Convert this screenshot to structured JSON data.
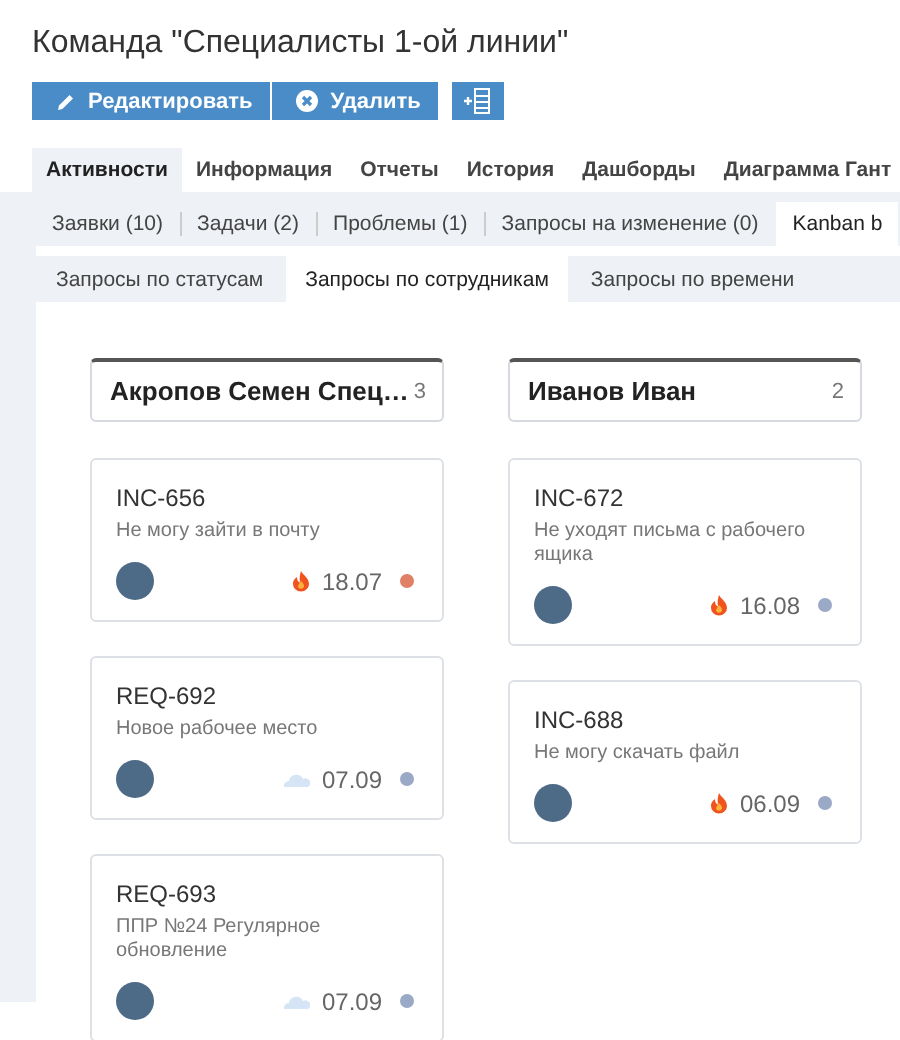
{
  "title": "Команда \"Специалисты 1-ой линии\"",
  "toolbar": [
    {
      "kind": "edit",
      "label": "Редактировать"
    },
    {
      "kind": "delete",
      "label": "Удалить"
    },
    {
      "kind": "add-column"
    }
  ],
  "tabs": [
    {
      "label": "Активности",
      "selected": true
    },
    {
      "label": "Информация",
      "selected": false
    },
    {
      "label": "Отчеты",
      "selected": false
    },
    {
      "label": "История",
      "selected": false
    },
    {
      "label": "Дашборды",
      "selected": false
    },
    {
      "label": "Диаграмма Гант",
      "selected": false
    }
  ],
  "subtabs": [
    {
      "label": "Заявки (10)",
      "selected": false
    },
    {
      "label": "Задачи (2)",
      "selected": false
    },
    {
      "label": "Проблемы (1)",
      "selected": false
    },
    {
      "label": "Запросы на изменение (0)",
      "selected": false
    },
    {
      "label": "Kanban b",
      "selected": true
    }
  ],
  "views": [
    {
      "label": "Запросы по статусам",
      "selected": false
    },
    {
      "label": "Запросы по сотрудникам",
      "selected": true
    },
    {
      "label": "Запросы по времени",
      "selected": false
    }
  ],
  "columns": [
    {
      "name": "Акропов Семен Спец…",
      "count": "3",
      "cards": [
        {
          "id": "INC-656",
          "title": "Не могу зайти в почту",
          "kind": "urgent",
          "date": "18.07",
          "color": "#e08066"
        },
        {
          "id": "REQ-692",
          "title": "Новое рабочее место",
          "kind": "calm",
          "date": "07.09",
          "color": "#9aa9c6"
        },
        {
          "id": "REQ-693",
          "title": "ППР №24 Регулярное обновление",
          "kind": "calm",
          "date": "07.09",
          "color": "#9aa9c6"
        }
      ]
    },
    {
      "name": "Иванов Иван",
      "count": "2",
      "cards": [
        {
          "id": "INC-672",
          "title": "Не уходят письма с рабочего ящика",
          "kind": "urgent",
          "date": "16.08",
          "color": "#9aa9c6"
        },
        {
          "id": "INC-688",
          "title": "Не могу скачать файл",
          "kind": "urgent",
          "date": "06.09",
          "color": "#9aa9c6"
        }
      ]
    }
  ]
}
